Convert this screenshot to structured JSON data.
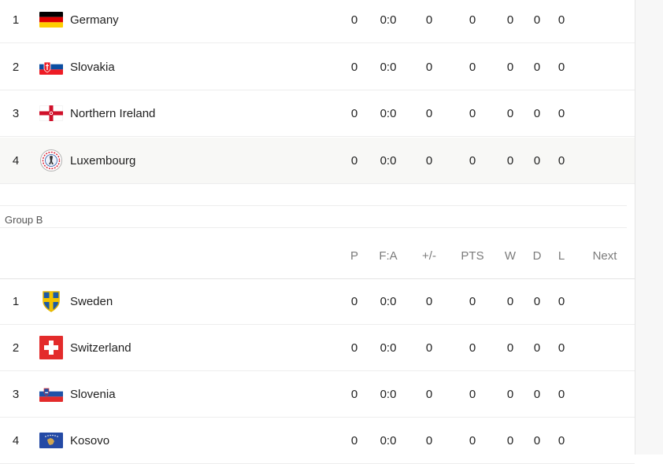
{
  "group_a": {
    "rows": [
      {
        "rank": "1",
        "team": "Germany",
        "flag": "germany-flag-icon",
        "p": "0",
        "fa": "0:0",
        "gd": "0",
        "pts": "0",
        "w": "0",
        "d": "0",
        "l": "0"
      },
      {
        "rank": "2",
        "team": "Slovakia",
        "flag": "slovakia-flag-icon",
        "p": "0",
        "fa": "0:0",
        "gd": "0",
        "pts": "0",
        "w": "0",
        "d": "0",
        "l": "0"
      },
      {
        "rank": "3",
        "team": "Northern Ireland",
        "flag": "northern-ireland-flag-icon",
        "p": "0",
        "fa": "0:0",
        "gd": "0",
        "pts": "0",
        "w": "0",
        "d": "0",
        "l": "0"
      },
      {
        "rank": "4",
        "team": "Luxembourg",
        "flag": "luxembourg-crest-icon",
        "p": "0",
        "fa": "0:0",
        "gd": "0",
        "pts": "0",
        "w": "0",
        "d": "0",
        "l": "0"
      }
    ]
  },
  "group_b": {
    "label": "Group B",
    "headers": {
      "p": "P",
      "fa": "F:A",
      "gd": "+/-",
      "pts": "PTS",
      "w": "W",
      "d": "D",
      "l": "L",
      "next": "Next"
    },
    "rows": [
      {
        "rank": "1",
        "team": "Sweden",
        "flag": "sweden-crest-icon",
        "p": "0",
        "fa": "0:0",
        "gd": "0",
        "pts": "0",
        "w": "0",
        "d": "0",
        "l": "0"
      },
      {
        "rank": "2",
        "team": "Switzerland",
        "flag": "switzerland-flag-icon",
        "p": "0",
        "fa": "0:0",
        "gd": "0",
        "pts": "0",
        "w": "0",
        "d": "0",
        "l": "0"
      },
      {
        "rank": "3",
        "team": "Slovenia",
        "flag": "slovenia-flag-icon",
        "p": "0",
        "fa": "0:0",
        "gd": "0",
        "pts": "0",
        "w": "0",
        "d": "0",
        "l": "0"
      },
      {
        "rank": "4",
        "team": "Kosovo",
        "flag": "kosovo-flag-icon",
        "p": "0",
        "fa": "0:0",
        "gd": "0",
        "pts": "0",
        "w": "0",
        "d": "0",
        "l": "0"
      }
    ]
  },
  "colors": {
    "row_highlight": "#f8f8f6",
    "header_text": "#7b7b7b",
    "divider": "#ededed"
  }
}
